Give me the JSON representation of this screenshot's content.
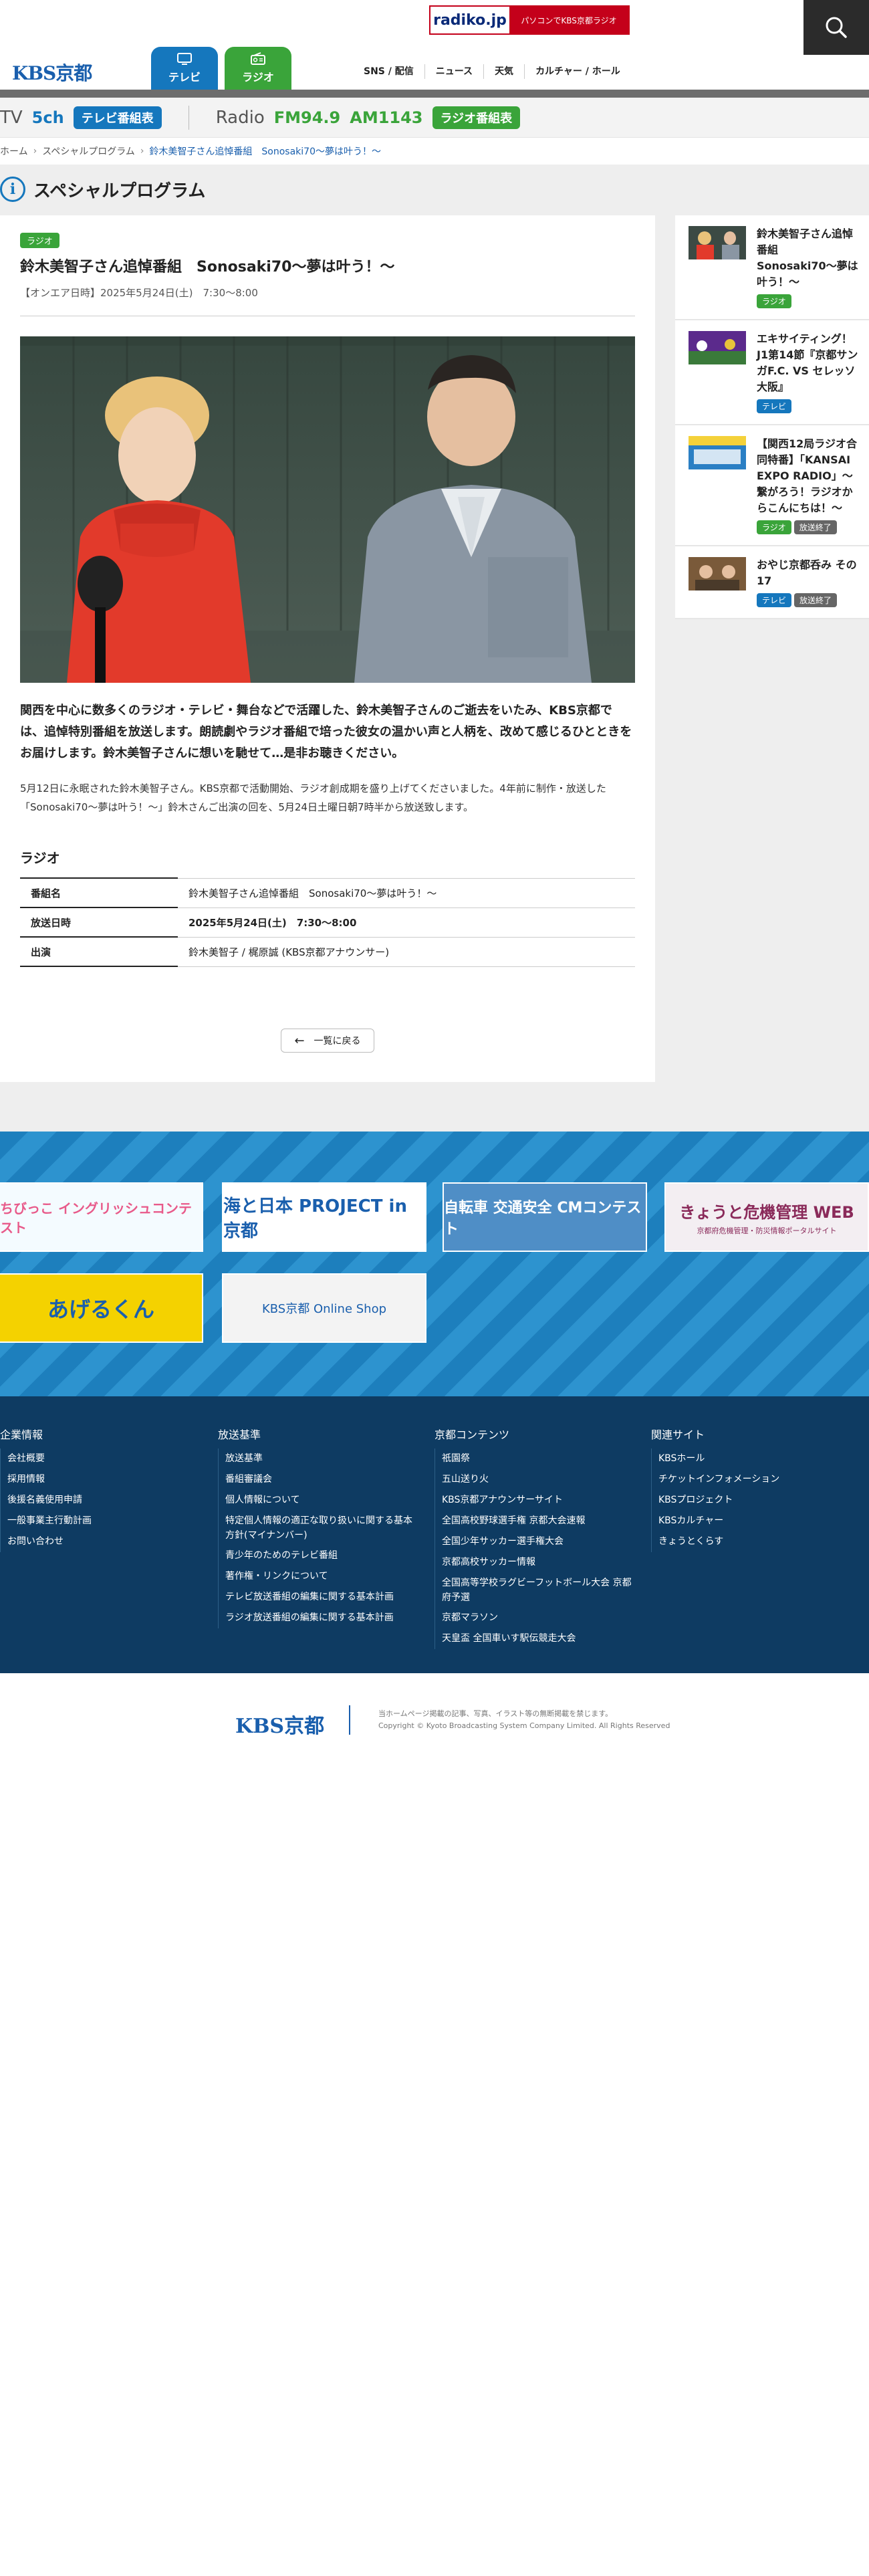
{
  "header": {
    "radiko_logo": "radiko.jp",
    "radiko_text": "パソコンでKBS京都ラジオ",
    "logo": "KBS京都",
    "tabs": [
      {
        "label": "テレビ"
      },
      {
        "label": "ラジオ"
      }
    ],
    "nav": [
      "SNS / 配信",
      "ニュース",
      "天気",
      "カルチャー / ホール"
    ]
  },
  "channel": {
    "tv_label": "TV",
    "tv_num": "5ch",
    "tv_button": "テレビ番組表",
    "radio_label": "Radio",
    "fm": "FM94.9",
    "am": "AM1143",
    "radio_button": "ラジオ番組表"
  },
  "breadcrumb": [
    "ホーム",
    "スペシャルプログラム",
    "鈴木美智子さん追悼番組　Sonosaki70〜夢は叶う！〜"
  ],
  "section_title": "スペシャルプログラム",
  "article": {
    "badge": "ラジオ",
    "title": "鈴木美智子さん追悼番組　Sonosaki70〜夢は叶う！〜",
    "air": "【オンエア日時】2025年5月24日(土)　7:30〜8:00",
    "lead": "関西を中心に数多くのラジオ・テレビ・舞台などで活躍した、鈴木美智子さんのご逝去をいたみ、KBS京都では、追悼特別番組を放送します。朗読劇やラジオ番組で培った彼女の温かい声と人柄を、改めて感じるひとときをお届けします。鈴木美智子さんに想いを馳せて…是非お聴きください。",
    "body": "5月12日に永眠された鈴木美智子さん。KBS京都で活動開始、ラジオ創成期を盛り上げてくださいました。4年前に制作・放送した「Sonosaki70〜夢は叶う！〜」鈴木さんご出演の回を、5月24日土曜日朝7時半から放送致します。",
    "info_title": "ラジオ",
    "info_rows": [
      {
        "k": "番組名",
        "v": "鈴木美智子さん追悼番組　Sonosaki70〜夢は叶う！〜"
      },
      {
        "k": "放送日時",
        "v": "2025年5月24日(土)　7:30〜8:00"
      },
      {
        "k": "出演",
        "v": "鈴木美智子 / 梶原誠 (KBS京都アナウンサー)"
      }
    ],
    "back": "一覧に戻る"
  },
  "sidebar": [
    {
      "title": "鈴木美智子さん追悼番組　Sonosaki70〜夢は叶う！〜",
      "badges": [
        "ラジオ"
      ]
    },
    {
      "title": "エキサイティング！ J1第14節『京都サンガF.C. VS セレッソ大阪』",
      "badges": [
        "テレビ"
      ]
    },
    {
      "title": "【関西12局ラジオ合同特番】「KANSAI EXPO RADIO」〜繋がろう！ラジオからこんにちは！〜",
      "badges": [
        "ラジオ",
        "放送終了"
      ]
    },
    {
      "title": "おやじ京都呑み その17",
      "badges": [
        "テレビ",
        "放送終了"
      ]
    }
  ],
  "banners": [
    {
      "text": "ちびっこ イングリッシュコンテスト"
    },
    {
      "text": "海と日本 PROJECT in 京都"
    },
    {
      "text": "自転車 交通安全 CMコンテスト"
    },
    {
      "text": "きょうと危機管理 WEB",
      "sub": "京都府危機管理・防災情報ポータルサイト"
    },
    {
      "text": "あげるくん"
    },
    {
      "text": "KBS京都 Online Shop"
    }
  ],
  "footer": {
    "cols": [
      {
        "head": "企業情報",
        "items": [
          "会社概要",
          "採用情報",
          "後援名義使用申請",
          "一般事業主行動計画",
          "お問い合わせ"
        ]
      },
      {
        "head": "放送基準",
        "items": [
          "放送基準",
          "番組審議会",
          "個人情報について",
          "特定個人情報の適正な取り扱いに関する基本方針(マイナンバー)",
          "青少年のためのテレビ番組",
          "著作権・リンクについて",
          "テレビ放送番組の編集に関する基本計画",
          "ラジオ放送番組の編集に関する基本計画"
        ]
      },
      {
        "head": "京都コンテンツ",
        "items": [
          "祇園祭",
          "五山送り火",
          "KBS京都アナウンサーサイト",
          "全国高校野球選手権 京都大会速報",
          "全国少年サッカー選手権大会",
          "京都高校サッカー情報",
          "全国高等学校ラグビーフットボール大会 京都府予選",
          "京都マラソン",
          "天皇盃 全国車いす駅伝競走大会"
        ]
      },
      {
        "head": "関連サイト",
        "items": [
          "KBSホール",
          "チケットインフォメーション",
          "KBSプロジェクト",
          "KBSカルチャー",
          "きょうとくらす"
        ]
      }
    ],
    "copy_logo": "KBS京都",
    "copy_line1": "当ホームページ掲載の記事、写真、イラスト等の無断掲載を禁じます。",
    "copy_line2": "Copyright © Kyoto Broadcasting System Company Limited. All Rights Reserved"
  }
}
